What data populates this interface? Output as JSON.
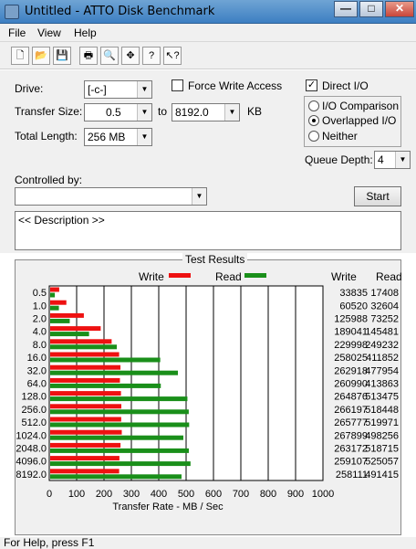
{
  "window": {
    "title": "Untitled - ATTO Disk Benchmark"
  },
  "menu": [
    "File",
    "View",
    "Help"
  ],
  "toolbar": {
    "icons": [
      "new-icon",
      "open-icon",
      "save-icon",
      "print-icon",
      "print-preview-icon",
      "move-icon",
      "help-icon",
      "context-help-icon"
    ]
  },
  "form": {
    "drive_label": "Drive:",
    "drive_value": "[-c-]",
    "transfer_size_label": "Transfer Size:",
    "transfer_from": "0.5",
    "to_label": "to",
    "transfer_to": "8192.0",
    "kb_label": "KB",
    "total_length_label": "Total Length:",
    "total_length_value": "256 MB",
    "force_write_label": "Force Write Access",
    "direct_io_label": "Direct I/O",
    "io_comparison_label": "I/O Comparison",
    "overlapped_io_label": "Overlapped I/O",
    "neither_label": "Neither",
    "queue_depth_label": "Queue Depth:",
    "queue_depth_value": "4",
    "controlled_by_label": "Controlled by:",
    "controlled_by_value": "",
    "start_label": "Start",
    "description_text": "<< Description >>"
  },
  "results": {
    "title": "Test Results",
    "write_label": "Write",
    "read_label": "Read",
    "write_col": "Write",
    "read_col": "Read",
    "x_axis_title": "Transfer Rate - MB / Sec",
    "colors": {
      "write": "#ee1111",
      "read": "#1a8f1a"
    }
  },
  "chart_data": {
    "type": "bar",
    "orientation": "horizontal",
    "categories": [
      "0.5",
      "1.0",
      "2.0",
      "4.0",
      "8.0",
      "16.0",
      "32.0",
      "64.0",
      "128.0",
      "256.0",
      "512.0",
      "1024.0",
      "2048.0",
      "4096.0",
      "8192.0"
    ],
    "series": [
      {
        "name": "Write",
        "values": [
          33835,
          60520,
          125988,
          189041,
          229998,
          258025,
          262918,
          260990,
          264876,
          266197,
          265777,
          267899,
          263172,
          259107,
          258111
        ]
      },
      {
        "name": "Read",
        "values": [
          17408,
          32604,
          73252,
          145481,
          249232,
          411852,
          477954,
          413863,
          513475,
          518448,
          519971,
          498256,
          518715,
          525057,
          491415
        ]
      }
    ],
    "xlabel": "Transfer Rate - MB / Sec",
    "xticks": [
      "0",
      "100",
      "200",
      "300",
      "400",
      "500",
      "600",
      "700",
      "800",
      "900",
      "1000"
    ],
    "xlim": [
      0,
      1000
    ],
    "grid": true
  },
  "status": {
    "text": "For Help, press F1"
  }
}
